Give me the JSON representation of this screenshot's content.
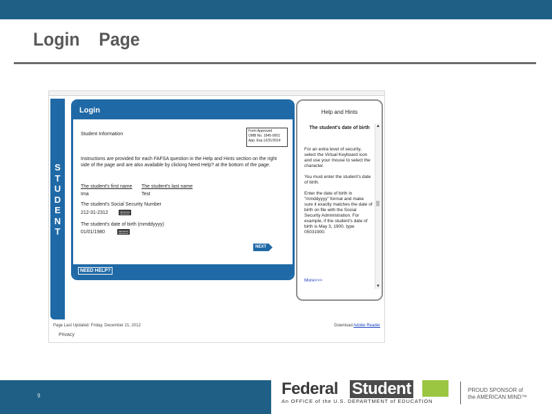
{
  "slide": {
    "title": "Login    Page",
    "page_number": "9"
  },
  "sidebar": {
    "letters": [
      "S",
      "T",
      "U",
      "D",
      "E",
      "N",
      "T"
    ]
  },
  "login": {
    "header": "Login",
    "section_title": "Student Information",
    "form_approved": [
      "Form Approved",
      "OMB No. 1845-0001",
      "App. Exp.12/31/2014"
    ],
    "instructions": "Instructions are provided for each FAFSA question in the Help and Hints section on the right side of the page and are also available by clicking Need Help? at the bottom of the page.",
    "first_name_label": "The student's first name",
    "first_name_value": "Ima",
    "last_name_label": "The student's last name",
    "last_name_value": "Test",
    "ssn_label": "The student's Social Security Number",
    "ssn_value": "212-31-2312",
    "dob_label": "The student's date of birth (mmddyyyy)",
    "dob_value": "01/01/1980",
    "next_label": "NEXT",
    "need_help_label": "NEED HELP?"
  },
  "help": {
    "title": "Help and Hints",
    "subtitle": "The student's date of birth",
    "paragraphs": [
      "For an extra level of security, select the Virtual Keyboard icon and use your mouse to select the character.",
      "You must enter the student's date of birth.",
      "Enter the date of birth in \"mmddyyyy\" format and make sure it exactly matches the date of birth on file with the Social Security Administration. For example, if the student's date of birth is May 3, 1900, type 05031900."
    ],
    "more": "More>>>"
  },
  "footer": {
    "updated": "Page Last Updated: Friday, December 21, 2012",
    "download_prefix": "Download",
    "download_link": "Adobe Reader",
    "privacy": "Privacy"
  },
  "logo": {
    "federal": "Federal",
    "student": "Student",
    "sub": "An OFFICE of the U.S. DEPARTMENT of EDUCATION",
    "tag_line1": "PROUD SPONSOR of",
    "tag_line2": "the AMERICAN MIND™"
  },
  "colors": {
    "bar": "#1f5f85",
    "panel_blue": "#1f69a6",
    "logo_green": "#9bc642"
  }
}
